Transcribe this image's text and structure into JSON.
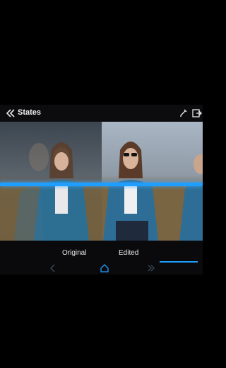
{
  "header": {
    "title": "States",
    "icons": [
      "double-chevron-left-icon",
      "pen-icon",
      "exit-icon"
    ]
  },
  "compare": {
    "left_label": "Original",
    "right_label": "Edited",
    "accent_color": "#1e9fff"
  },
  "nav": {
    "icons": [
      "chevron-left-icon",
      "home-icon",
      "forward-icon"
    ]
  }
}
